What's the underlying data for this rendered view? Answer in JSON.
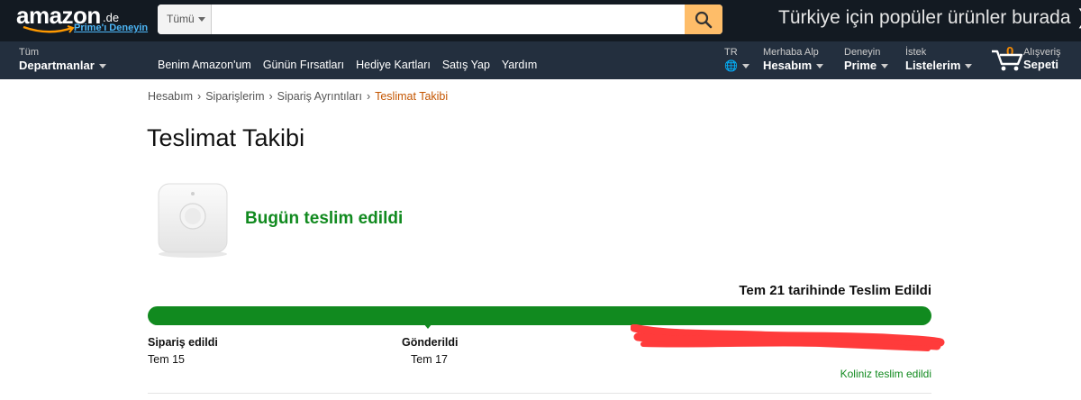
{
  "header": {
    "logo_text": "amazon",
    "logo_tld": ".de",
    "prime_link": "Prime'ı Deneyin",
    "search_category": "Tümü",
    "search_value": "",
    "promo": "Türkiye için popüler ürünler burada",
    "promo_arrow": "❯"
  },
  "nav": {
    "departments_line1": "Tüm",
    "departments_line2": "Departmanlar",
    "links": [
      "Benim Amazon'um",
      "Günün Fırsatları",
      "Hediye Kartları",
      "Satış Yap",
      "Yardım"
    ],
    "lang": "TR",
    "account_line1": "Merhaba Alp",
    "account_line2": "Hesabım",
    "prime_line1": "Deneyin",
    "prime_line2": "Prime",
    "lists_line1": "İstek",
    "lists_line2": "Listelerim",
    "cart_count": "0",
    "cart_line1": "Alışveriş",
    "cart_line2": "Sepeti"
  },
  "breadcrumb": [
    "Hesabım",
    "Siparişlerim",
    "Sipariş Ayrıntıları",
    "Teslimat Takibi"
  ],
  "page_title": "Teslimat Takibi",
  "status": "Bugün teslim edildi",
  "tracking": {
    "delivered_label": "Tem 21 tarihinde Teslim Edildi",
    "progress": 1.0,
    "steps": [
      {
        "label": "Sipariş edildi",
        "date": "Tem 15"
      },
      {
        "label": "Gönderildi",
        "date": "Tem 17"
      }
    ],
    "final_note": "Koliniz teslim edildi"
  },
  "colors": {
    "header_bg": "#131a22",
    "nav_bg": "#232f3e",
    "search_button": "#febd69",
    "success_green": "#118a1f",
    "breadcrumb_current": "#c45500",
    "redaction": "#ff3b3b"
  },
  "icons": {
    "search": "magnifier-icon",
    "cart": "cart-icon",
    "globe": "globe-icon"
  }
}
